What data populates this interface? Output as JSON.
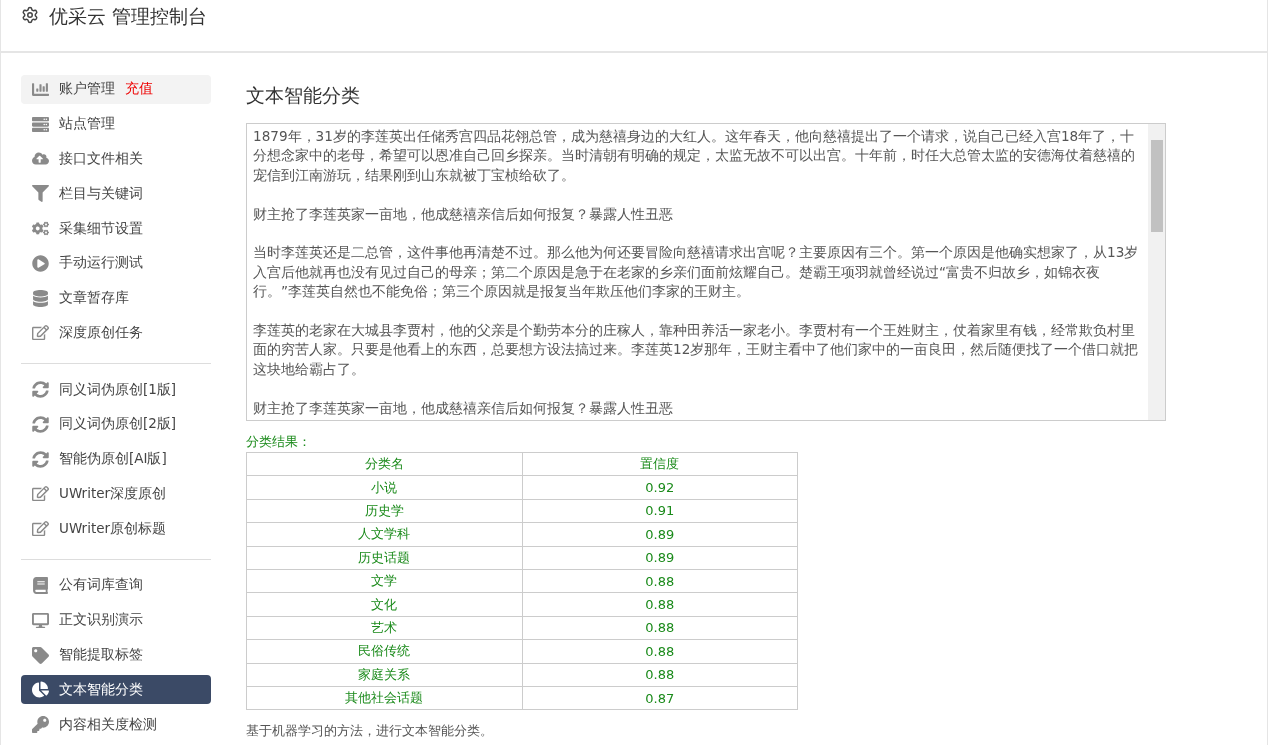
{
  "header": {
    "title": "优采云 管理控制台"
  },
  "sidebar": {
    "groups": [
      {
        "items": [
          {
            "label": "账户管理",
            "badge": "充值",
            "selected": false,
            "highlighted": true
          },
          {
            "label": "站点管理",
            "selected": false,
            "highlighted": false
          },
          {
            "label": "接口文件相关",
            "selected": false,
            "highlighted": false
          },
          {
            "label": "栏目与关键词",
            "selected": false,
            "highlighted": false
          },
          {
            "label": "采集细节设置",
            "selected": false,
            "highlighted": false
          },
          {
            "label": "手动运行测试",
            "selected": false,
            "highlighted": false
          },
          {
            "label": "文章暂存库",
            "selected": false,
            "highlighted": false
          },
          {
            "label": "深度原创任务",
            "selected": false,
            "highlighted": false
          }
        ]
      },
      {
        "items": [
          {
            "label": "同义词伪原创[1版]",
            "selected": false,
            "highlighted": false
          },
          {
            "label": "同义词伪原创[2版]",
            "selected": false,
            "highlighted": false
          },
          {
            "label": "智能伪原创[AI版]",
            "selected": false,
            "highlighted": false
          },
          {
            "label": "UWriter深度原创",
            "selected": false,
            "highlighted": false
          },
          {
            "label": "UWriter原创标题",
            "selected": false,
            "highlighted": false
          }
        ]
      },
      {
        "items": [
          {
            "label": "公有词库查询",
            "selected": false,
            "highlighted": false
          },
          {
            "label": "正文识别演示",
            "selected": false,
            "highlighted": false
          },
          {
            "label": "智能提取标签",
            "selected": false,
            "highlighted": false
          },
          {
            "label": "文本智能分类",
            "selected": true,
            "highlighted": false
          },
          {
            "label": "内容相关度检测",
            "selected": false,
            "highlighted": false
          }
        ]
      }
    ]
  },
  "main": {
    "title": "文本智能分类",
    "text_area": {
      "paragraphs": [
        "1879年，31岁的李莲英出任储秀宫四品花翎总管，成为慈禧身边的大红人。这年春天，他向慈禧提出了一个请求，说自己已经入宫18年了，十分想念家中的老母，希望可以恩准自己回乡探亲。当时清朝有明确的规定，太监无故不可以出宫。十年前，时任大总管太监的安德海仗着慈禧的宠信到江南游玩，结果刚到山东就被丁宝桢给砍了。",
        "财主抢了李莲英家一亩地，他成慈禧亲信后如何报复？暴露人性丑恶",
        "当时李莲英还是二总管，这件事他再清楚不过。那么他为何还要冒险向慈禧请求出宫呢？主要原因有三个。第一个原因是他确实想家了，从13岁入宫后他就再也没有见过自己的母亲；第二个原因是急于在老家的乡亲们面前炫耀自己。楚霸王项羽就曾经说过“富贵不归故乡，如锦衣夜行。”李莲英自然也不能免俗；第三个原因就是报复当年欺压他们李家的王财主。",
        "李莲英的老家在大城县李贾村，他的父亲是个勤劳本分的庄稼人，靠种田养活一家老小。李贾村有一个王姓财主，仗着家里有钱，经常欺负村里面的穷苦人家。只要是他看上的东西，总要想方设法搞过来。李莲英12岁那年，王财主看中了他们家中的一亩良田，然后随便找了一个借口就把这块地给霸占了。",
        "财主抢了李莲英家一亩地，他成慈禧亲信后如何报复？暴露人性丑恶"
      ]
    },
    "result_label": "分类结果：",
    "table": {
      "columns": [
        "分类名",
        "置信度"
      ],
      "rows": [
        [
          "小说",
          "0.92"
        ],
        [
          "历史学",
          "0.91"
        ],
        [
          "人文学科",
          "0.89"
        ],
        [
          "历史话题",
          "0.89"
        ],
        [
          "文学",
          "0.88"
        ],
        [
          "文化",
          "0.88"
        ],
        [
          "艺术",
          "0.88"
        ],
        [
          "民俗传统",
          "0.88"
        ],
        [
          "家庭关系",
          "0.88"
        ],
        [
          "其他社会话题",
          "0.87"
        ]
      ]
    },
    "footnote": "基于机器学习的方法，进行文本智能分类。"
  }
}
